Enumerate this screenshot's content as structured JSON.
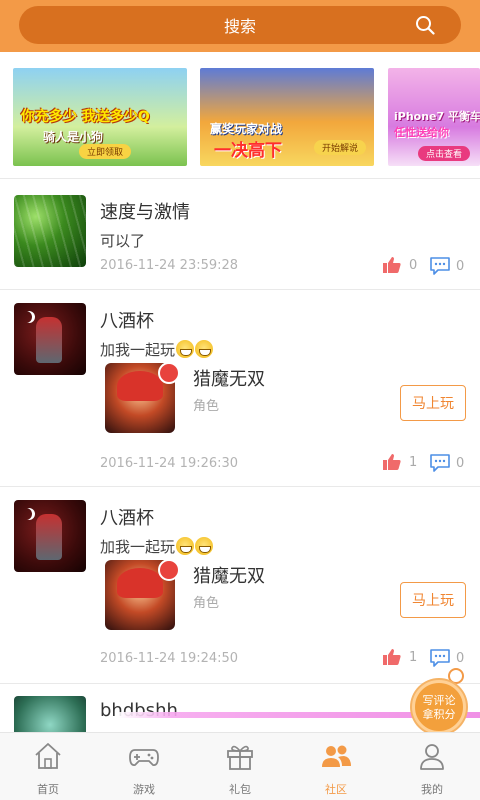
{
  "search": {
    "label": "搜索"
  },
  "banners": [
    {
      "line1": "你充多少 我送多少Q",
      "line2": "骑人是小狗",
      "button": "立即领取"
    },
    {
      "line1": "赢奖玩家对战",
      "line2": "一决高下",
      "button": "开始解说"
    },
    {
      "line1": "iPhone7 平衡车",
      "line2": "任性送给你",
      "button": "点击查看"
    }
  ],
  "posts": [
    {
      "name": "速度与激情",
      "comment": "可以了",
      "time": "2016-11-24 23:59:28",
      "likes": "0",
      "comments": "0"
    },
    {
      "name": "八酒杯",
      "comment": "加我一起玩",
      "game": {
        "name": "猎魔无双",
        "type": "角色",
        "button": "马上玩"
      },
      "time": "2016-11-24 19:26:30",
      "likes": "1",
      "comments": "0"
    },
    {
      "name": "八酒杯",
      "comment": "加我一起玩",
      "game": {
        "name": "猎魔无双",
        "type": "角色",
        "button": "马上玩"
      },
      "time": "2016-11-24 19:24:50",
      "likes": "1",
      "comments": "0"
    },
    {
      "name": "bhdbshh"
    }
  ],
  "float": {
    "label": "写评论 拿积分"
  },
  "nav": [
    {
      "label": "首页"
    },
    {
      "label": "游戏"
    },
    {
      "label": "礼包"
    },
    {
      "label": "社区"
    },
    {
      "label": "我的"
    }
  ],
  "colors": {
    "accent": "#f39a47",
    "accent_dark": "#d8701f",
    "like": "#f06a6a",
    "comment_icon": "#4d8fe6"
  }
}
